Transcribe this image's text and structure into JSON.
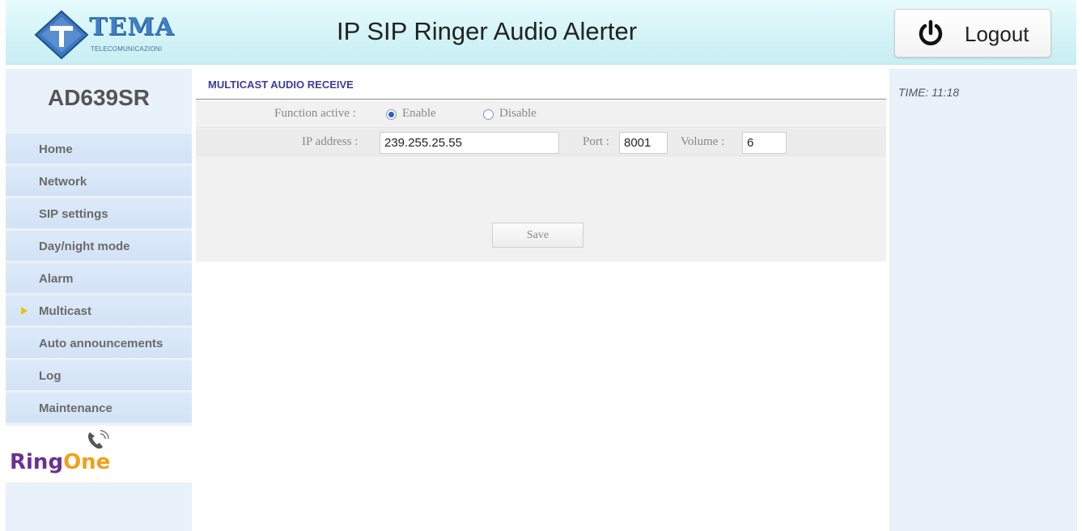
{
  "header": {
    "logo": {
      "word": "TEMA",
      "subtitle": "TELECOMUNICAZIONI"
    },
    "title": "IP SIP Ringer Audio Alerter",
    "logout_label": "Logout"
  },
  "sidebar": {
    "model": "AD639SR",
    "items": [
      {
        "label": "Home",
        "active": false
      },
      {
        "label": "Network",
        "active": false
      },
      {
        "label": "SIP settings",
        "active": false
      },
      {
        "label": "Day/night mode",
        "active": false
      },
      {
        "label": "Alarm",
        "active": false
      },
      {
        "label": "Multicast",
        "active": true
      },
      {
        "label": "Auto announcements",
        "active": false
      },
      {
        "label": "Log",
        "active": false
      },
      {
        "label": "Maintenance",
        "active": false
      }
    ],
    "brand_logo": {
      "part1": "Ring",
      "part2": "One"
    }
  },
  "main": {
    "section_title": "MULTICAST AUDIO RECEIVE",
    "function_active_label": "Function active :",
    "enable_label": "Enable",
    "disable_label": "Disable",
    "function_active_value": "Enable",
    "ip_label": "IP address :",
    "ip_value": "239.255.25.55",
    "port_label": "Port :",
    "port_value": "8001",
    "volume_label": "Volume :",
    "volume_value": "6",
    "save_label": "Save"
  },
  "right": {
    "time": "TIME: 11:18"
  },
  "colors": {
    "header_bg": "#d2f3f6",
    "sidebar_bg": "#e9f1fb",
    "nav_item_bg": "#d2e3f6",
    "active_arrow": "#e8c21c",
    "section_title": "#3c3c9e",
    "panel_bg": "#f1f1f1"
  },
  "icons": {
    "logout": "power-icon",
    "brand": "phone-signal-icon",
    "active_nav": "triangle-arrow-icon"
  }
}
